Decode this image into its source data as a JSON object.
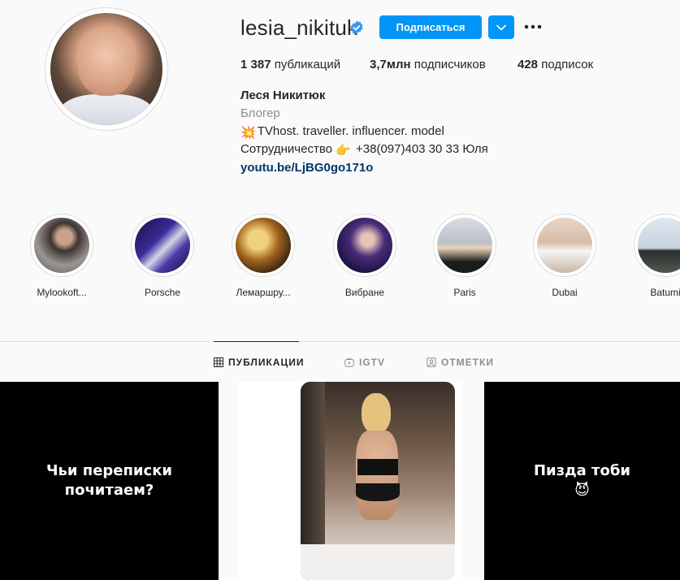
{
  "profile": {
    "username": "lesia_nikituk",
    "follow_label": "Подписаться",
    "stats": {
      "posts_count": "1 387",
      "posts_label": "публикаций",
      "followers_count": "3,7млн",
      "followers_label": "подписчиков",
      "following_count": "428",
      "following_label": "подписок"
    },
    "bio": {
      "name": "Леся Никитюк",
      "category": "Блогер",
      "line1_emoji": "💥",
      "line1": "TVhost. traveller. influencer. model",
      "line2_before": "Сотрудничество",
      "line2_emoji": "👉",
      "line2_after": "+38(097)403 30 33 Юля",
      "link": "youtu.be/LjBG0go171o"
    }
  },
  "highlights": [
    {
      "label": "Mylookoft..."
    },
    {
      "label": "Porsche"
    },
    {
      "label": "Лемаршру..."
    },
    {
      "label": "Вибране"
    },
    {
      "label": "Paris"
    },
    {
      "label": "Dubai"
    },
    {
      "label": "Batumi"
    }
  ],
  "tabs": [
    {
      "label": "ПУБЛИКАЦИИ",
      "active": true,
      "icon": "grid-icon"
    },
    {
      "label": "IGTV",
      "active": false,
      "icon": "igtv-icon"
    },
    {
      "label": "ОТМЕТКИ",
      "active": false,
      "icon": "tagged-icon"
    }
  ],
  "posts": [
    {
      "text_line1": "Чьи переписки",
      "text_line2": "почитаем?"
    },
    {
      "text": ""
    },
    {
      "text_line1": "Пизда тоби",
      "text_line2": "😈"
    }
  ],
  "colors": {
    "accent": "#0095f6",
    "link": "#00376b",
    "muted": "#8e8e8e",
    "text": "#262626"
  }
}
